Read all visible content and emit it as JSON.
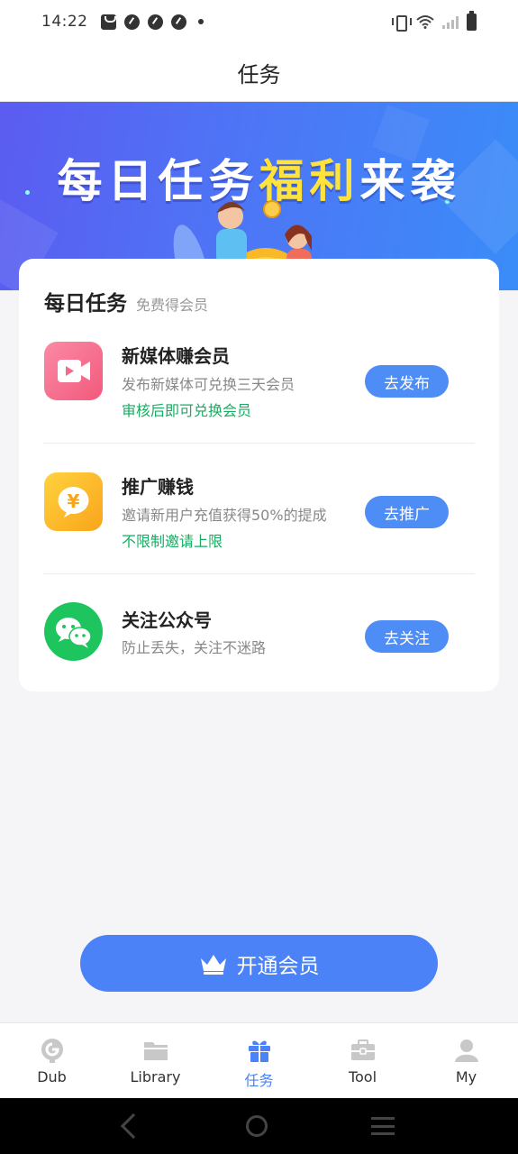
{
  "status_bar": {
    "time": "14:22"
  },
  "header": {
    "title": "任务"
  },
  "banner": {
    "title_part1": "每日任务",
    "title_highlight": "福利",
    "title_part2": "来袭"
  },
  "daily_tasks": {
    "title": "每日任务",
    "subtitle": "免费得会员",
    "items": [
      {
        "name": "新媒体赚会员",
        "desc": "发布新媒体可兑换三天会员",
        "note": "审核后即可兑换会员",
        "button": "去发布",
        "icon": "video-icon",
        "icon_color": "#f46b8a"
      },
      {
        "name": "推广赚钱",
        "desc": "邀请新用户充值获得50%的提成",
        "note": "不限制邀请上限",
        "button": "去推广",
        "icon": "yuan-coin-icon",
        "icon_color": "#fbb21f"
      },
      {
        "name": "关注公众号",
        "desc": "防止丢失，关注不迷路",
        "button": "去关注",
        "icon": "wechat-icon",
        "icon_color": "#1ec45d"
      }
    ]
  },
  "vip_button": {
    "label": "开通会员"
  },
  "bottom_nav": {
    "items": [
      {
        "label": "Dub",
        "icon": "microphone-icon"
      },
      {
        "label": "Library",
        "icon": "folder-icon"
      },
      {
        "label": "任务",
        "icon": "gift-icon",
        "active": true
      },
      {
        "label": "Tool",
        "icon": "toolbox-icon"
      },
      {
        "label": "My",
        "icon": "person-icon"
      }
    ]
  },
  "colors": {
    "accent": "#4b82f7",
    "success_text": "#1aab62",
    "banner_highlight": "#ffe23b"
  }
}
